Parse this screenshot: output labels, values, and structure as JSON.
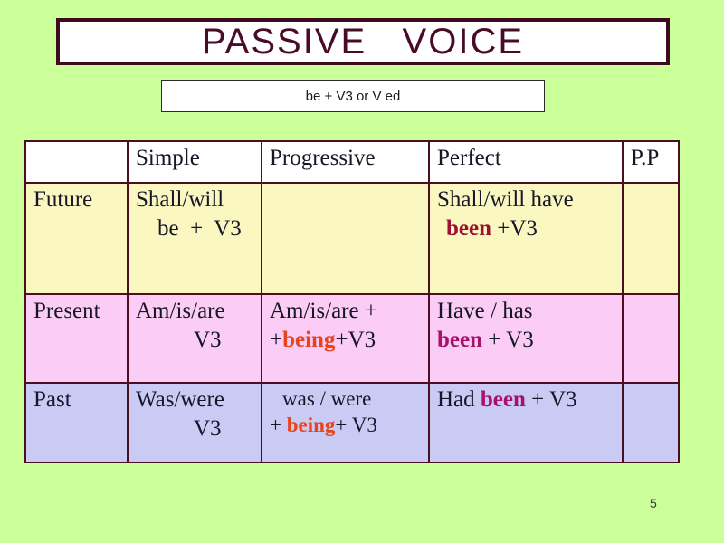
{
  "slide": {
    "background_color": "#caff99",
    "page_number": "5"
  },
  "title": {
    "text": "PASSIVE   VOICE",
    "color": "#4a0b28",
    "border_color": "#3d0a20",
    "background": "#ffffff"
  },
  "subtitle": {
    "text": "be + V3 or V ed",
    "background": "#ffffff",
    "border_color": "#2b2b2b"
  },
  "table": {
    "columns": [
      "",
      "Simple",
      "Progressive",
      "Perfect",
      "P.P"
    ],
    "border_color": "#4a1020",
    "rows": [
      {
        "label": "Future",
        "row_color": "#faf8c0",
        "cells": {
          "simple": {
            "line1": "Shall/will",
            "line2": "be  +  V3"
          },
          "progressive": {
            "line1": "",
            "line2": ""
          },
          "perfect": {
            "line1": "Shall/will have",
            "been": "been",
            "after_been": " +V3"
          },
          "pp": ""
        }
      },
      {
        "label": "Present",
        "row_color": "#fbcdf6",
        "cells": {
          "simple": {
            "line1": "Am/is/are",
            "line2": "V3"
          },
          "progressive": {
            "line1": "Am/is/are +",
            "before_being": "+",
            "being": "being",
            "after_being": "+V3"
          },
          "perfect": {
            "line1": "Have / has",
            "been": "been",
            "after_been": " + V3"
          },
          "pp": ""
        }
      },
      {
        "label": "Past",
        "row_color": "#cacbf4",
        "cells": {
          "simple": {
            "line1": "Was/were",
            "line2": "V3"
          },
          "progressive": {
            "line1": "was / were",
            "before_being": "+ ",
            "being": "being",
            "after_being": "+ V3"
          },
          "perfect": {
            "line1": "Had ",
            "been": "been",
            "after_been": " + V3"
          },
          "pp": ""
        }
      }
    ]
  },
  "colors": {
    "been_dark_red": "#9c1032",
    "been_magenta": "#a8106a",
    "being_orange": "#e8441c"
  }
}
